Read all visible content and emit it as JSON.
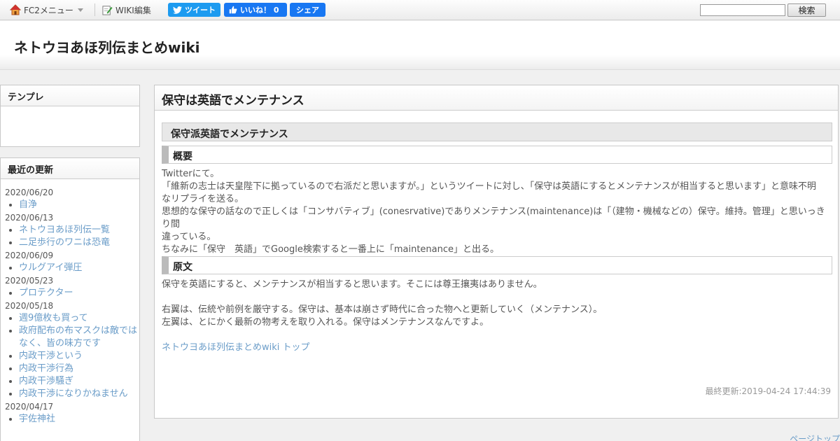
{
  "topbar": {
    "fc2_menu": "FC2メニュー",
    "wiki_edit": "WIKI編集",
    "tweet": "ツイート",
    "like": "いいね！ 0",
    "share": "シェア",
    "search_button": "検索",
    "search_value": ""
  },
  "header": {
    "title": "ネトウヨあほ列伝まとめwiki"
  },
  "sidebar": {
    "template_title": "テンプレ",
    "updates_title": "最近の更新",
    "groups": [
      {
        "date": "2020/06/20",
        "items": [
          "自浄"
        ]
      },
      {
        "date": "2020/06/13",
        "items": [
          "ネトウヨあほ列伝一覧",
          "二足歩行のワニは恐竜"
        ]
      },
      {
        "date": "2020/06/09",
        "items": [
          "ウルグアイ弾圧"
        ]
      },
      {
        "date": "2020/05/23",
        "items": [
          "プロテクター"
        ]
      },
      {
        "date": "2020/05/18",
        "items": [
          "週9億枚も買って",
          "政府配布の布マスクは敵ではなく、皆の味方です",
          "内政干渉という",
          "内政干渉行為",
          "内政干渉騒ぎ",
          "内政干渉になりかねません"
        ]
      },
      {
        "date": "2020/04/17",
        "items": [
          "宇佐神社"
        ]
      }
    ]
  },
  "main": {
    "page_title": "保守は英語でメンテナンス",
    "section_title": "保守派英語でメンテナンス",
    "overview_heading": "概要",
    "overview_lines": [
      "Twitterにて。",
      "「維新の志士は天皇陛下に拠っているので右派だと思いますが。」というツイートに対し、「保守は英語にするとメンテナンスが相当すると思います」と意味不明",
      "なリプライを送る。",
      "思想的な保守の話なので正しくは「コンサバティブ」(conesrvative)でありメンテナンス(maintenance)は「（建物・機械などの）保守。維持。管理」と思いっきり間",
      "違っている。",
      "ちなみに「保守　英語」でGoogle検索すると一番上に「maintenance」と出る。"
    ],
    "original_heading": "原文",
    "original_lines": [
      "保守を英語にすると、メンテナンスが相当すると思います。そこには尊王攘夷はありません。",
      "",
      "右翼は、伝統や前例を厳守する。保守は、基本は崩さず時代に合った物へと更新していく（メンテナンス）。",
      "左翼は、とにかく最新の物考えを取り入れる。保守はメンテナンスなんですよ。"
    ],
    "top_link": "ネトウヨあほ列伝まとめwiki トップ",
    "last_modified": "最終更新:2019-04-24 17:44:39",
    "page_top": "ページトップ"
  },
  "colors": {
    "link": "#6a9cc8",
    "twitter": "#1d9bf0",
    "facebook": "#1877f2"
  }
}
